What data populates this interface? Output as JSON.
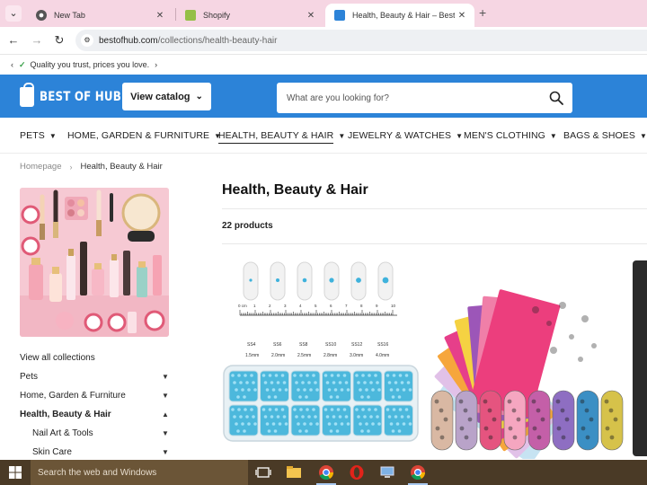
{
  "browser": {
    "tabs": [
      {
        "title": "New Tab",
        "active": false
      },
      {
        "title": "Shopify",
        "active": false
      },
      {
        "title": "Health, Beauty & Hair – Best Of",
        "active": true
      }
    ],
    "close_glyph": "✕",
    "new_tab_glyph": "+",
    "url_host": "bestofhub.com",
    "url_path": "/collections/health-beauty-hair"
  },
  "announcement": {
    "text": "Quality you trust, prices you love."
  },
  "store": {
    "logo_text": "BEST OF HUB",
    "catalog_label": "View catalog",
    "search_placeholder": "What are you looking for?"
  },
  "nav": [
    {
      "label": "PETS",
      "current": false
    },
    {
      "label": "HOME, GARDEN & FURNITURE",
      "current": false
    },
    {
      "label": "HEALTH, BEAUTY & HAIR",
      "current": true
    },
    {
      "label": "JEWELRY & WATCHES",
      "current": false
    },
    {
      "label": "MEN'S CLOTHING",
      "current": false
    },
    {
      "label": "BAGS & SHOES",
      "current": false
    }
  ],
  "breadcrumb": {
    "home": "Homepage",
    "current": "Health, Beauty & Hair"
  },
  "sidebar": {
    "items": [
      {
        "label": "View all collections",
        "chevron": "",
        "active": false,
        "sub": false
      },
      {
        "label": "Pets",
        "chevron": "down",
        "active": false,
        "sub": false
      },
      {
        "label": "Home, Garden & Furniture",
        "chevron": "down",
        "active": false,
        "sub": false
      },
      {
        "label": "Health, Beauty & Hair",
        "chevron": "up",
        "active": true,
        "sub": false
      },
      {
        "label": "Nail Art & Tools",
        "chevron": "down",
        "active": false,
        "sub": true
      },
      {
        "label": "Skin Care",
        "chevron": "down",
        "active": false,
        "sub": true
      }
    ]
  },
  "collection": {
    "title": "Health, Beauty & Hair",
    "count": "22 products"
  },
  "ruler": {
    "numbers": [
      "0 cm",
      "1",
      "2",
      "3",
      "4",
      "5",
      "6",
      "7",
      "8",
      "9",
      "10"
    ],
    "sizes": [
      "SS4",
      "SS6",
      "SS8",
      "SS10",
      "SS12",
      "SS16"
    ],
    "mm": [
      "1.5mm",
      "2.0mm",
      "2.5mm",
      "2.8mm",
      "3.0mm",
      "4.0mm"
    ]
  },
  "taskbar": {
    "search_placeholder": "Search the web and Windows"
  }
}
